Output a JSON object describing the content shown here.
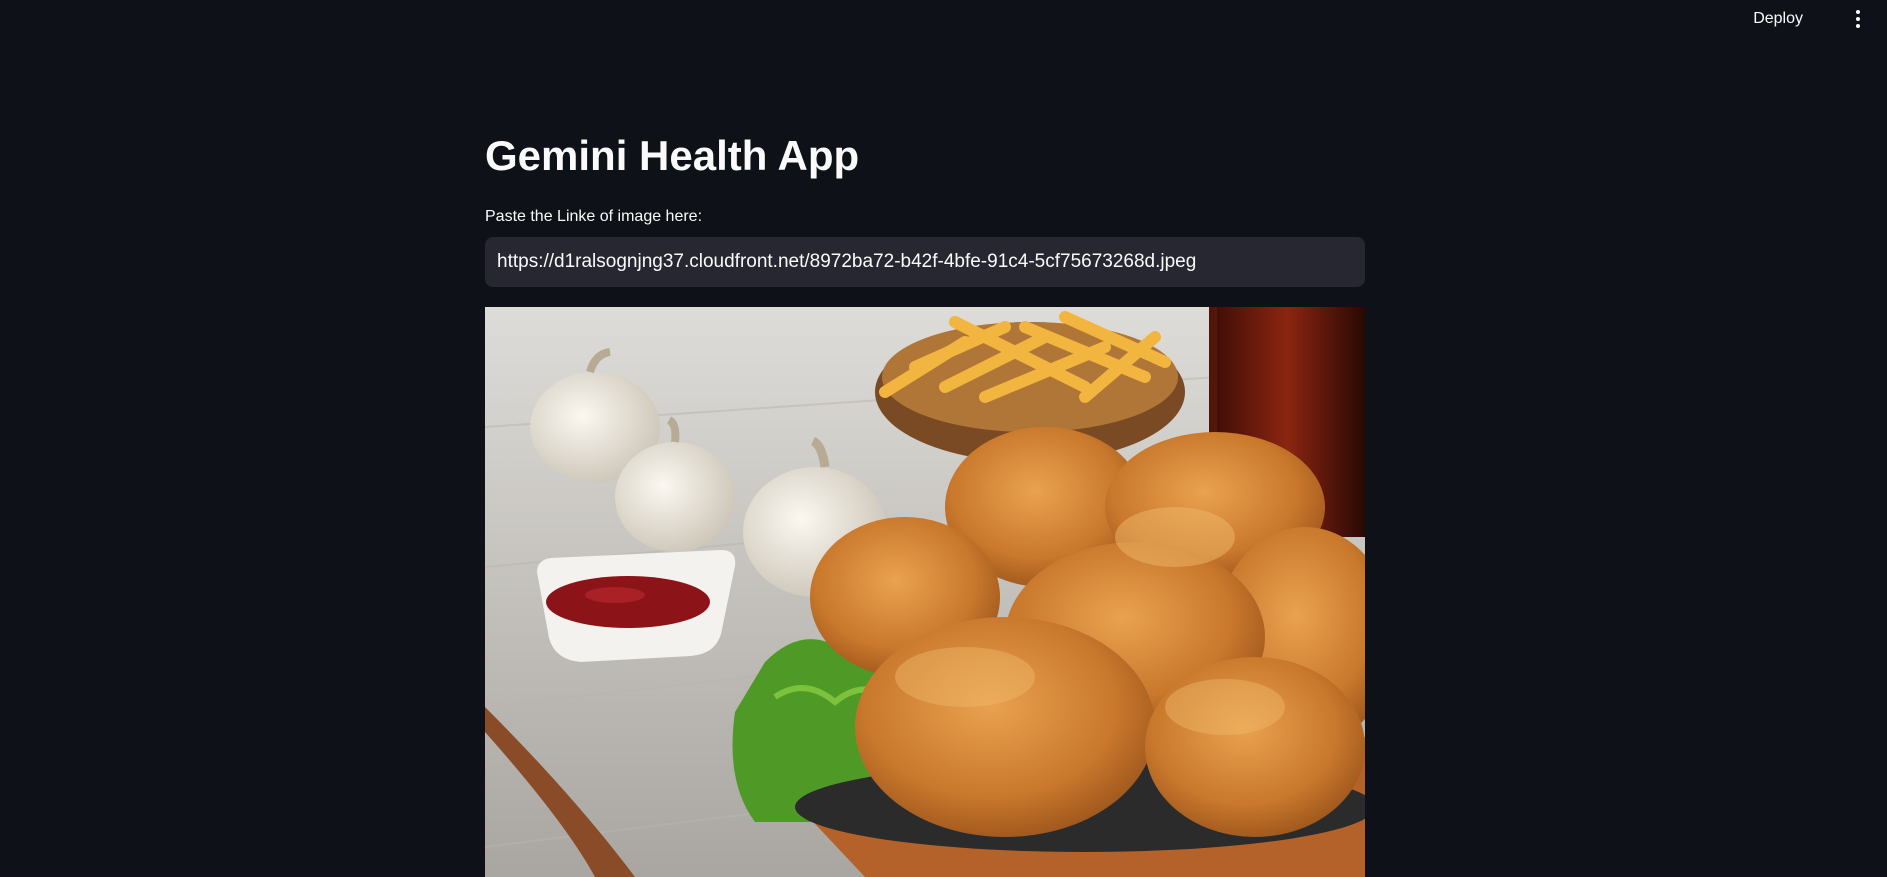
{
  "header": {
    "deploy_label": "Deploy",
    "menu_icon": "vertical-ellipsis-icon"
  },
  "main": {
    "title": "Gemini Health App",
    "input": {
      "label": "Paste the Linke of image here:",
      "value": "https://d1ralsognjng37.cloudfront.net/8972ba72-b42f-4bfe-91c4-5cf75673268d.jpeg"
    },
    "image": {
      "content": "fried-chicken-meal-photo"
    }
  },
  "colors": {
    "background": "#0e1117",
    "input_background": "#262730",
    "text": "#fafafa"
  }
}
